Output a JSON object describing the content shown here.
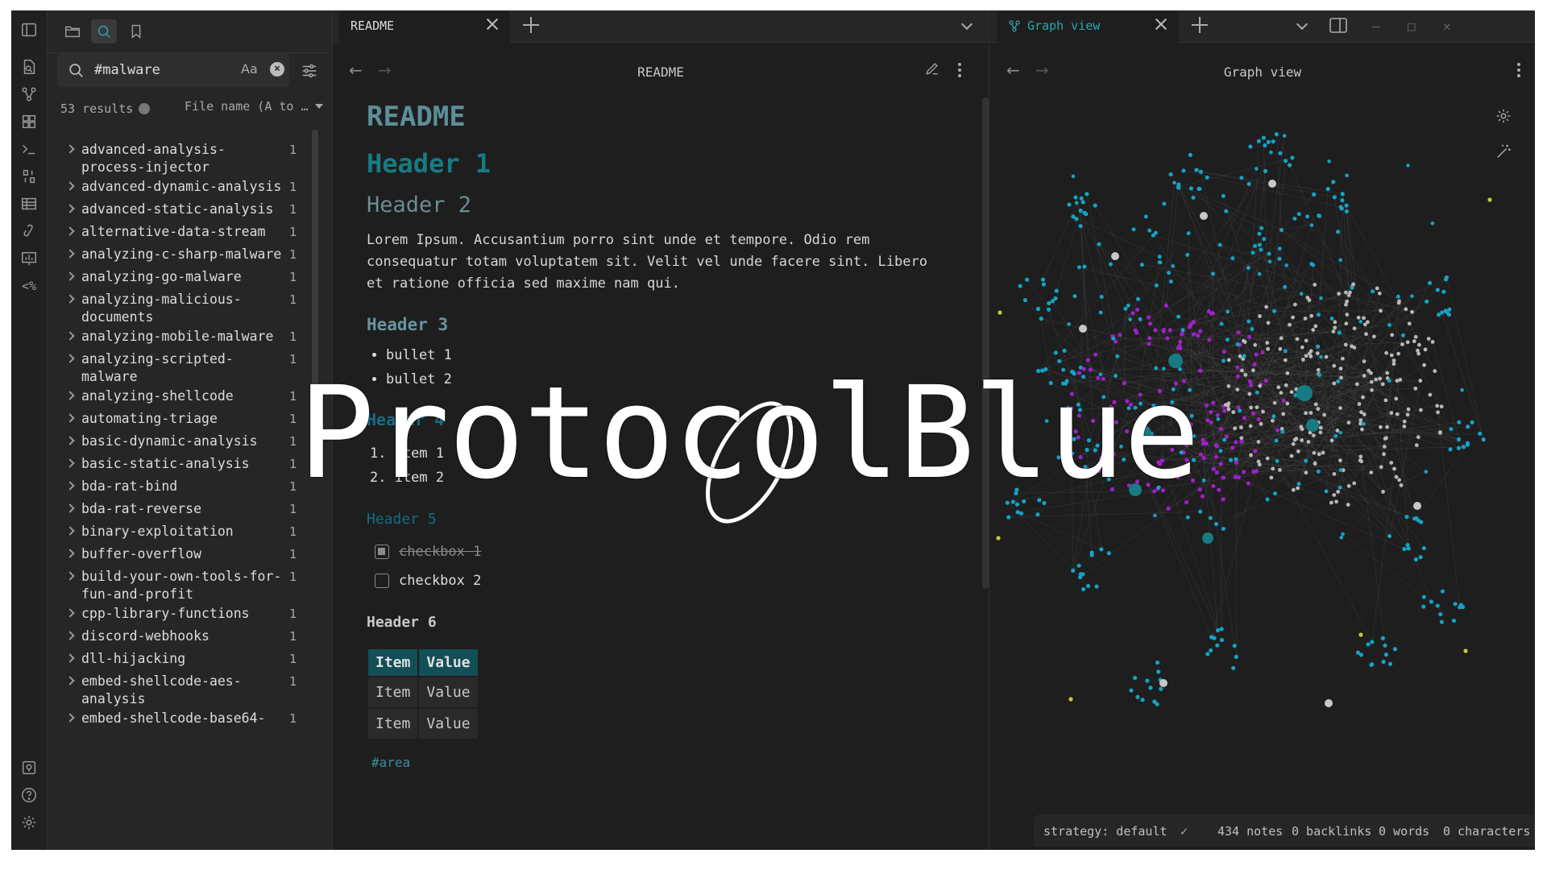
{
  "sidebar": {
    "search_value": "#malware",
    "case_label": "Aa",
    "clear_label": "×",
    "results_count": "53 results",
    "sort_label": "File name (A to …",
    "results": [
      {
        "name": "advanced-analysis-process-injector",
        "count": "1"
      },
      {
        "name": "advanced-dynamic-analysis",
        "count": "1"
      },
      {
        "name": "advanced-static-analysis",
        "count": "1"
      },
      {
        "name": "alternative-data-stream",
        "count": "1"
      },
      {
        "name": "analyzing-c-sharp-malware",
        "count": "1"
      },
      {
        "name": "analyzing-go-malware",
        "count": "1"
      },
      {
        "name": "analyzing-malicious-documents",
        "count": "1"
      },
      {
        "name": "analyzing-mobile-malware",
        "count": "1"
      },
      {
        "name": "analyzing-scripted-malware",
        "count": "1"
      },
      {
        "name": "analyzing-shellcode",
        "count": "1"
      },
      {
        "name": "automating-triage",
        "count": "1"
      },
      {
        "name": "basic-dynamic-analysis",
        "count": "1"
      },
      {
        "name": "basic-static-analysis",
        "count": "1"
      },
      {
        "name": "bda-rat-bind",
        "count": "1"
      },
      {
        "name": "bda-rat-reverse",
        "count": "1"
      },
      {
        "name": "binary-exploitation",
        "count": "1"
      },
      {
        "name": "buffer-overflow",
        "count": "1"
      },
      {
        "name": "build-your-own-tools-for-fun-and-profit",
        "count": "1"
      },
      {
        "name": "cpp-library-functions",
        "count": "1"
      },
      {
        "name": "discord-webhooks",
        "count": "1"
      },
      {
        "name": "dll-hijacking",
        "count": "1"
      },
      {
        "name": "embed-shellcode-aes-analysis",
        "count": "1"
      },
      {
        "name": "embed-shellcode-base64-",
        "count": "1"
      }
    ]
  },
  "left_pane": {
    "tab_label": "README",
    "view_title": "README",
    "doc": {
      "title": "README",
      "h1": "Header 1",
      "h2": "Header 2",
      "paragraph": "Lorem Ipsum. Accusantium porro sint unde et tempore. Odio rem consequatur totam voluptatem sit. Velit vel unde facere sint. Libero et ratione officia sed maxime nam qui.",
      "h3": "Header 3",
      "bullets": [
        "bullet 1",
        "bullet 2"
      ],
      "h4": "Header 4",
      "ordered": [
        "1. item 1",
        "2. item 2"
      ],
      "h5": "Header 5",
      "checkboxes": [
        {
          "label": "checkbox 1",
          "checked": true
        },
        {
          "label": "checkbox 2",
          "checked": false
        }
      ],
      "h6": "Header 6",
      "table": {
        "headers": [
          "Item",
          "Value"
        ],
        "rows": [
          [
            "Item",
            "Value"
          ],
          [
            "Item",
            "Value"
          ]
        ]
      },
      "tag": "#area"
    }
  },
  "right_pane": {
    "tab_label": "Graph view",
    "view_title": "Graph view",
    "status": {
      "strategy": "strategy: default",
      "notes": "434 notes",
      "backlinks": "0 backlinks",
      "words": "0 words",
      "characters": "0 characters"
    }
  },
  "watermark": "ProtocolBlue",
  "colors": {
    "accent": "#2aa7ad",
    "magenta": "#a020c8",
    "cyan": "#16a2c6",
    "gray": "#b8b8b8",
    "yellow": "#c9c93a"
  },
  "icons": {
    "ribbon": [
      "open-file-icon",
      "graph-icon",
      "canvas-icon",
      "terminal-icon",
      "templates-icon",
      "table-icon",
      "link-icon",
      "chart-icon",
      "percent-code-icon",
      "vault-icon",
      "help-icon",
      "settings-icon"
    ],
    "sidebar": [
      "sidebar-toggle-icon",
      "folder-icon",
      "search-icon",
      "bookmark-icon"
    ]
  }
}
